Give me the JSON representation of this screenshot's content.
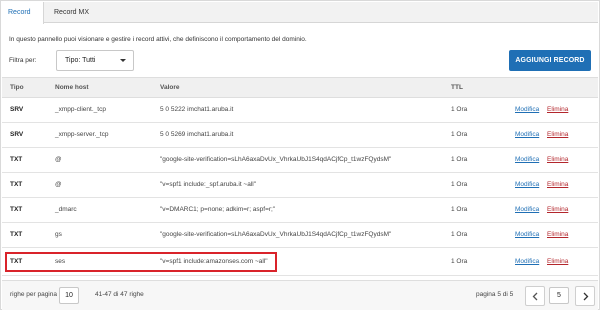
{
  "tabs": [
    {
      "label": "Record",
      "active": true
    },
    {
      "label": "Record MX",
      "active": false
    }
  ],
  "intro": "In questo pannello puoi visionare e gestire i record attivi, che definiscono il comportamento del dominio.",
  "filter": {
    "label": "Filtra per:",
    "selected": "Tipo: Tutti"
  },
  "add_button": "AGGIUNGI RECORD",
  "columns": {
    "type": "Tipo",
    "host": "Nome host",
    "value": "Valore",
    "ttl": "TTL"
  },
  "rows": [
    {
      "type": "SRV",
      "host": "_xmpp-client._tcp",
      "value": "5 0 5222 imchat1.aruba.it",
      "ttl": "1 Ora",
      "edit": "Modifica",
      "delete": "Elimina"
    },
    {
      "type": "SRV",
      "host": "_xmpp-server._tcp",
      "value": "5 0 5269 imchat1.aruba.it",
      "ttl": "1 Ora",
      "edit": "Modifica",
      "delete": "Elimina"
    },
    {
      "type": "TXT",
      "host": "@",
      "value": "\"google-site-verification=sLhA6axaDvUx_VhrkaUbJ1S4qdACjfCp_t1wzFQydsM\"",
      "ttl": "1 Ora",
      "edit": "Modifica",
      "delete": "Elimina"
    },
    {
      "type": "TXT",
      "host": "@",
      "value": "\"v=spf1 include:_spf.aruba.it ~all\"",
      "ttl": "1 Ora",
      "edit": "Modifica",
      "delete": "Elimina"
    },
    {
      "type": "TXT",
      "host": "_dmarc",
      "value": "\"v=DMARC1; p=none; adkim=r; aspf=r;\"",
      "ttl": "1 Ora",
      "edit": "Modifica",
      "delete": "Elimina"
    },
    {
      "type": "TXT",
      "host": "gs",
      "value": "\"google-site-verification=sLhA6axaDvUx_VhrkaUbJ1S4qdACjfCp_t1wzFQydsM\"",
      "ttl": "1 Ora",
      "edit": "Modifica",
      "delete": "Elimina"
    },
    {
      "type": "TXT",
      "host": "ses",
      "value": "\"v=spf1 include:amazonses.com ~all\"",
      "ttl": "1 Ora",
      "edit": "Modifica",
      "delete": "Elimina"
    }
  ],
  "footer": {
    "rows_label": "righe per pagina",
    "rows_value": "10",
    "range": "41-47 di 47 righe",
    "page_label": "pagina 5 di 5",
    "page_value": "5"
  },
  "icons": {
    "prev": "chevron-left-icon",
    "next": "chevron-right-icon",
    "caret": "caret-down-icon"
  },
  "colors": {
    "accent": "#1f6fb5",
    "delete": "#b3262c",
    "highlight": "#d9232a"
  }
}
